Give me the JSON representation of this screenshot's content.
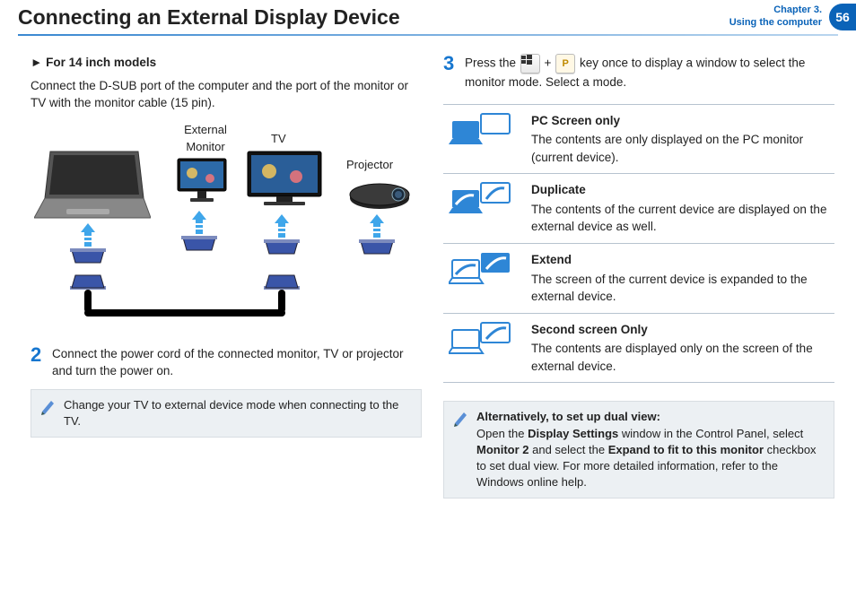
{
  "header": {
    "title": "Connecting an External Display Device",
    "chapter_line1": "Chapter 3.",
    "chapter_line2": "Using the computer",
    "page": "56"
  },
  "left": {
    "subhead_marker": "►",
    "subhead": "For 14 inch models",
    "intro": "Connect the D-SUB port of the computer and the port of the monitor or TV with the monitor cable (15 pin).",
    "labels": {
      "external_monitor": "External Monitor",
      "tv": "TV",
      "projector": "Projector"
    },
    "step2_num": "2",
    "step2": "Connect the power cord of the connected monitor, TV or projector and turn the power on.",
    "note": "Change your TV to external device mode when connecting to the TV."
  },
  "right": {
    "step3_num": "3",
    "step3_a": "Press the ",
    "step3_plus": "+",
    "step3_p": "P",
    "step3_b": " key once to display a window to select the monitor mode. Select a mode.",
    "modes": [
      {
        "name": "PC Screen only",
        "desc": "The contents are only displayed on the PC monitor (current device)."
      },
      {
        "name": "Duplicate",
        "desc": "The contents of the current device are displayed on the external device as well."
      },
      {
        "name": "Extend",
        "desc": "The screen of the current device is expanded to the external device."
      },
      {
        "name": "Second screen Only",
        "desc": "The contents are displayed only on the screen of the external device."
      }
    ],
    "alt_title": "Alternatively, to set up dual view:",
    "alt_body_a": "Open the ",
    "alt_b1": "Display Settings",
    "alt_body_b": " window in the Control Panel, select ",
    "alt_b2": "Monitor 2",
    "alt_body_c": " and select the ",
    "alt_b3": "Expand to fit to this monitor",
    "alt_body_d": " checkbox to set dual view. For more detailed information, refer to the Windows online help."
  }
}
